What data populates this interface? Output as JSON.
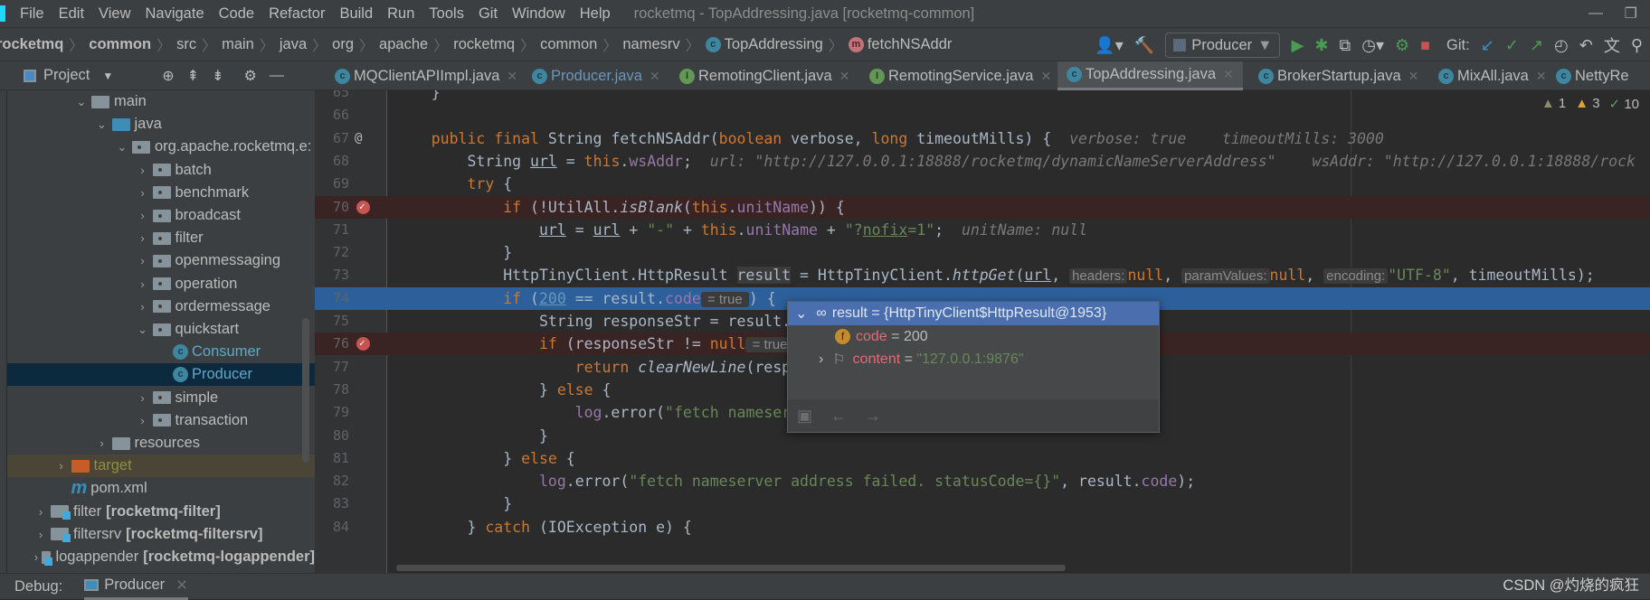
{
  "window_title": "rocketmq - TopAddressing.java [rocketmq-common]",
  "menu": [
    "File",
    "Edit",
    "View",
    "Navigate",
    "Code",
    "Refactor",
    "Build",
    "Run",
    "Tools",
    "Git",
    "Window",
    "Help"
  ],
  "breadcrumbs": [
    "rocketmq",
    "common",
    "src",
    "main",
    "java",
    "org",
    "apache",
    "rocketmq",
    "common",
    "namesrv",
    "TopAddressing",
    "fetchNSAddr"
  ],
  "toolbar": {
    "run_config": "Producer",
    "git_label": "Git:"
  },
  "project_panel": {
    "title": "Project"
  },
  "tree": [
    {
      "label": "main",
      "level": 2,
      "expanded": true,
      "icon": "folder"
    },
    {
      "label": "java",
      "level": 3,
      "expanded": true,
      "icon": "source-folder"
    },
    {
      "label": "org.apache.rocketmq.e:",
      "level": 4,
      "expanded": true,
      "icon": "package"
    },
    {
      "label": "batch",
      "level": 5,
      "expanded": false,
      "icon": "package"
    },
    {
      "label": "benchmark",
      "level": 5,
      "expanded": false,
      "icon": "package"
    },
    {
      "label": "broadcast",
      "level": 5,
      "expanded": false,
      "icon": "package"
    },
    {
      "label": "filter",
      "level": 5,
      "expanded": false,
      "icon": "package"
    },
    {
      "label": "openmessaging",
      "level": 5,
      "expanded": false,
      "icon": "package"
    },
    {
      "label": "operation",
      "level": 5,
      "expanded": false,
      "icon": "package"
    },
    {
      "label": "ordermessage",
      "level": 5,
      "expanded": false,
      "icon": "package"
    },
    {
      "label": "quickstart",
      "level": 5,
      "expanded": true,
      "icon": "package"
    },
    {
      "label": "Consumer",
      "level": 6,
      "icon": "class-run",
      "color": "#5fa8c8"
    },
    {
      "label": "Producer",
      "level": 6,
      "icon": "class-run",
      "color": "#5fa8c8",
      "selected": true
    },
    {
      "label": "simple",
      "level": 5,
      "expanded": false,
      "icon": "package"
    },
    {
      "label": "transaction",
      "level": 5,
      "expanded": false,
      "icon": "package"
    },
    {
      "label": "resources",
      "level": 3,
      "expanded": false,
      "icon": "resources-folder"
    },
    {
      "label": "target",
      "level": 1,
      "expanded": false,
      "icon": "excluded-folder",
      "color": "#8f8f3b",
      "highlight": true
    },
    {
      "label": "pom.xml",
      "level": 1,
      "icon": "maven"
    },
    {
      "label": "filter",
      "module": "[rocketmq-filter]",
      "level": 0,
      "expanded": false,
      "icon": "module"
    },
    {
      "label": "filtersrv",
      "module": "[rocketmq-filtersrv]",
      "level": 0,
      "expanded": false,
      "icon": "module"
    },
    {
      "label": "logappender",
      "module": "[rocketmq-logappender]",
      "level": 0,
      "expanded": false,
      "icon": "module"
    }
  ],
  "tabs": [
    {
      "label": "MQClientAPIImpl.java",
      "icon": "c"
    },
    {
      "label": "Producer.java",
      "icon": "c-run",
      "modified": true
    },
    {
      "label": "RemotingClient.java",
      "icon": "i"
    },
    {
      "label": "RemotingService.java",
      "icon": "i"
    },
    {
      "label": "TopAddressing.java",
      "icon": "c",
      "active": true
    },
    {
      "label": "BrokerStartup.java",
      "icon": "c-run"
    },
    {
      "label": "MixAll.java",
      "icon": "c"
    },
    {
      "label": "NettyRe",
      "icon": "c"
    }
  ],
  "inspections": {
    "weak_warnings": "1",
    "warnings": "3",
    "typos": "10"
  },
  "code_lines": [
    {
      "n": "65",
      "t": [
        [
          "p",
          "    }"
        ]
      ]
    },
    {
      "n": "66",
      "t": []
    },
    {
      "n": "67",
      "marker": "@",
      "t": [
        [
          "kw",
          "    public final "
        ],
        [
          "p",
          "String "
        ],
        [
          "p",
          "fetchNSAddr("
        ],
        [
          "kw",
          "boolean "
        ],
        [
          "p",
          "verbose, "
        ],
        [
          "kw",
          "long "
        ],
        [
          "p",
          "timeoutMills) {  "
        ],
        [
          "hint",
          "verbose: true    timeoutMills: 3000"
        ]
      ]
    },
    {
      "n": "68",
      "t": [
        [
          "p",
          "        String "
        ],
        [
          "ul",
          "url"
        ],
        [
          "p",
          " = "
        ],
        [
          "kw",
          "this"
        ],
        [
          "p",
          "."
        ],
        [
          "field",
          "wsAddr"
        ],
        [
          "p",
          ";  "
        ],
        [
          "hint",
          "url: \"http://127.0.0.1:18888/rocketmq/dynamicNameServerAddress\"    wsAddr: \"http://127.0.0.1:18888/rock"
        ]
      ]
    },
    {
      "n": "69",
      "t": [
        [
          "kw",
          "        try "
        ],
        [
          "p",
          "{"
        ]
      ]
    },
    {
      "n": "70",
      "bp": true,
      "t": [
        [
          "kw",
          "            if "
        ],
        [
          "p",
          "(!UtilAll."
        ],
        [
          "it",
          "isBlank"
        ],
        [
          "p",
          "("
        ],
        [
          "kw",
          "this"
        ],
        [
          "p",
          "."
        ],
        [
          "field",
          "unitName"
        ],
        [
          "p",
          ")) {"
        ]
      ]
    },
    {
      "n": "71",
      "t": [
        [
          "p",
          "                "
        ],
        [
          "ul",
          "url"
        ],
        [
          "p",
          " = "
        ],
        [
          "ul",
          "url"
        ],
        [
          "p",
          " + "
        ],
        [
          "str",
          "\"-\""
        ],
        [
          "p",
          " + "
        ],
        [
          "kw",
          "this"
        ],
        [
          "p",
          "."
        ],
        [
          "field",
          "unitName"
        ],
        [
          "p",
          " + "
        ],
        [
          "str",
          "\"?"
        ],
        [
          "strul",
          "nofix"
        ],
        [
          "str",
          "=1\""
        ],
        [
          "p",
          ";  "
        ],
        [
          "hint",
          "unitName: null"
        ]
      ]
    },
    {
      "n": "72",
      "t": [
        [
          "p",
          "            }"
        ]
      ]
    },
    {
      "n": "73",
      "t": [
        [
          "p",
          "            HttpTinyClient.HttpResult "
        ],
        [
          "sel",
          "result"
        ],
        [
          "p",
          " = HttpTinyClient."
        ],
        [
          "it",
          "httpGet"
        ],
        [
          "p",
          "("
        ],
        [
          "ul",
          "url"
        ],
        [
          "p",
          ", "
        ],
        [
          "inlay",
          "headers:"
        ],
        [
          "kw",
          "null"
        ],
        [
          "p",
          ", "
        ],
        [
          "inlay",
          "paramValues:"
        ],
        [
          "kw",
          "null"
        ],
        [
          "p",
          ", "
        ],
        [
          "inlay",
          "encoding:"
        ],
        [
          "str",
          "\"UTF-8\""
        ],
        [
          "p",
          ", timeoutMills);"
        ]
      ]
    },
    {
      "n": "74",
      "current": true,
      "t": [
        [
          "kw",
          "            if "
        ],
        [
          "p",
          "("
        ],
        [
          "numul",
          "200"
        ],
        [
          "p",
          " == result."
        ],
        [
          "field",
          "code"
        ],
        [
          "inlay",
          " = true "
        ],
        [
          "p",
          ") {"
        ]
      ]
    },
    {
      "n": "75",
      "t": [
        [
          "p",
          "                String responseStr = result."
        ],
        [
          "field",
          "content"
        ],
        [
          "p",
          ";"
        ]
      ]
    },
    {
      "n": "76",
      "bp": true,
      "t": [
        [
          "kw",
          "                if "
        ],
        [
          "p",
          "(responseStr != "
        ],
        [
          "kw",
          "null"
        ],
        [
          "inlay",
          " = true "
        ],
        [
          "p",
          ") {"
        ]
      ]
    },
    {
      "n": "77",
      "t": [
        [
          "kw",
          "                    return "
        ],
        [
          "it",
          "clearNewLine"
        ],
        [
          "p",
          "(responseStr);"
        ]
      ]
    },
    {
      "n": "78",
      "t": [
        [
          "p",
          "                } "
        ],
        [
          "kw",
          "else "
        ],
        [
          "p",
          "{"
        ]
      ]
    },
    {
      "n": "79",
      "t": [
        [
          "p",
          "                    "
        ],
        [
          "field",
          "log"
        ],
        [
          "p",
          ".error("
        ],
        [
          "str",
          "\"fetch nameserver address is null\""
        ],
        [
          "p",
          ");"
        ]
      ]
    },
    {
      "n": "80",
      "t": [
        [
          "p",
          "                }"
        ]
      ]
    },
    {
      "n": "81",
      "t": [
        [
          "p",
          "            } "
        ],
        [
          "kw",
          "else "
        ],
        [
          "p",
          "{"
        ]
      ]
    },
    {
      "n": "82",
      "t": [
        [
          "p",
          "                "
        ],
        [
          "field",
          "log"
        ],
        [
          "p",
          ".error("
        ],
        [
          "str",
          "\"fetch nameserver address failed. statusCode={}\""
        ],
        [
          "p",
          ", result."
        ],
        [
          "field",
          "code"
        ],
        [
          "p",
          ");"
        ]
      ]
    },
    {
      "n": "83",
      "t": [
        [
          "p",
          "            }"
        ]
      ]
    },
    {
      "n": "84",
      "t": [
        [
          "p",
          "        } "
        ],
        [
          "kw",
          "catch "
        ],
        [
          "p",
          "(IOException e) {"
        ]
      ]
    }
  ],
  "debug_popup": {
    "header": "result = {HttpTinyClient$HttpResult@1953}",
    "fields": [
      {
        "name": "code",
        "eq": " = ",
        "value": "200",
        "icon": "field-icon"
      },
      {
        "name": "content",
        "eq": " = ",
        "value": "\"127.0.0.1:9876\"",
        "icon": "flag-icon"
      }
    ]
  },
  "debug_bar": {
    "label": "Debug:",
    "session": "Producer"
  },
  "watermark": "CSDN @灼烧的疯狂",
  "colors": {
    "current_line": "#2d5f9a",
    "breakpoint_line": "#3a2323",
    "keyword": "#cc7832",
    "string": "#6a8759",
    "field": "#9876aa"
  }
}
